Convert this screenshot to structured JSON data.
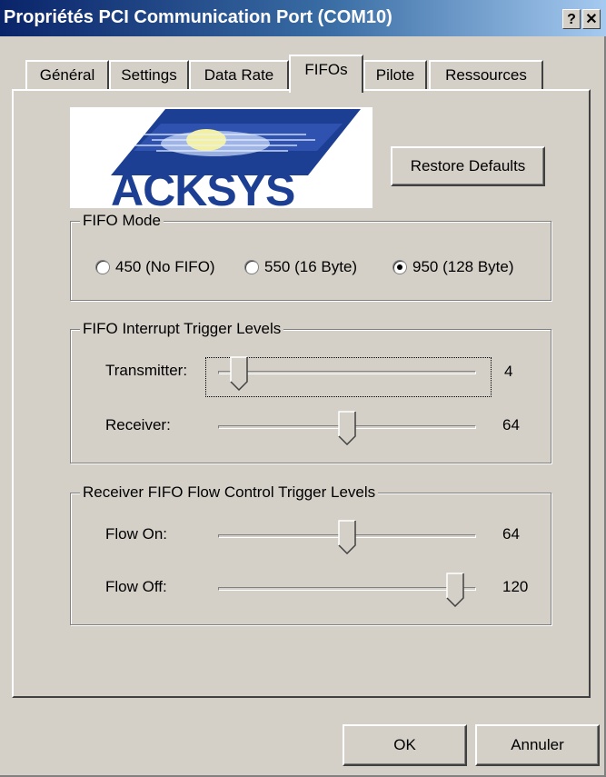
{
  "window": {
    "title": "Propriétés PCI Communication Port (COM10)",
    "help_glyph": "?",
    "close_glyph": "✕"
  },
  "tabs": [
    {
      "label": "Général",
      "active": false
    },
    {
      "label": "Settings",
      "active": false
    },
    {
      "label": "Data Rate",
      "active": false
    },
    {
      "label": "FIFOs",
      "active": true
    },
    {
      "label": "Pilote",
      "active": false
    },
    {
      "label": "Ressources",
      "active": false
    }
  ],
  "logo": {
    "text": "ACKSYS",
    "icon": "acksys-logo"
  },
  "buttons": {
    "restore_defaults": "Restore Defaults",
    "ok": "OK",
    "cancel": "Annuler"
  },
  "fifo_mode": {
    "legend": "FIFO Mode",
    "options": [
      "450 (No FIFO)",
      "550 (16 Byte)",
      "950 (128 Byte)"
    ],
    "selected": "950 (128 Byte)"
  },
  "interrupt": {
    "legend": "FIFO Interrupt Trigger Levels",
    "transmitter_label": "Transmitter:",
    "transmitter_value": "4",
    "transmitter_fraction": 0.05,
    "receiver_label": "Receiver:",
    "receiver_value": "64",
    "receiver_fraction": 0.5
  },
  "flow": {
    "legend": "Receiver FIFO Flow Control Trigger Levels",
    "on_label": "Flow On:",
    "on_value": "64",
    "on_fraction": 0.5,
    "off_label": "Flow Off:",
    "off_value": "120",
    "off_fraction": 0.95
  },
  "colors": {
    "titlebar_start": "#0a246a",
    "titlebar_end": "#a6caf0",
    "face": "#d4d0c8",
    "logo_blue": "#1c3f94"
  }
}
